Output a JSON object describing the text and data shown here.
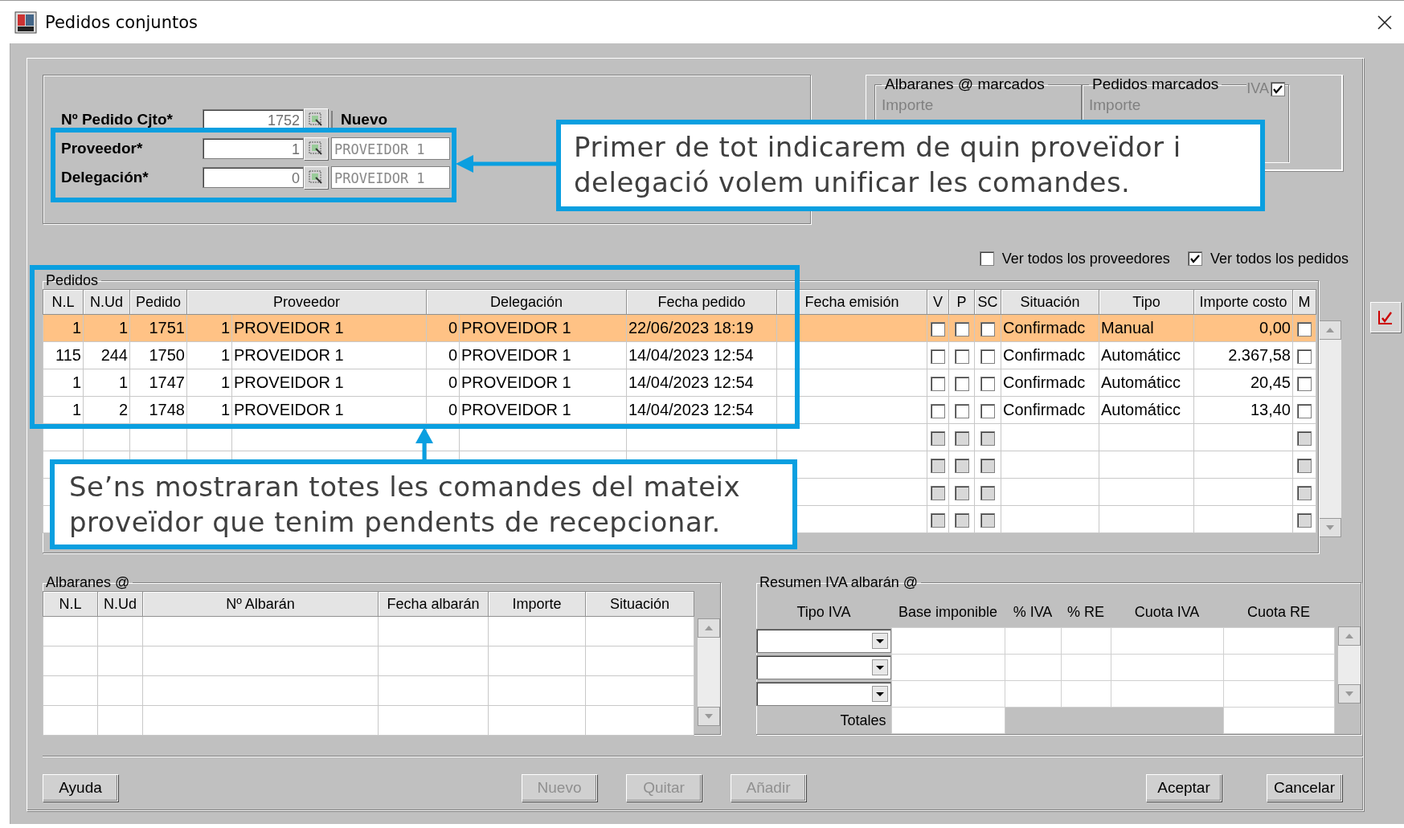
{
  "window": {
    "title": "Pedidos conjuntos"
  },
  "order_fields": [
    {
      "kind": "order",
      "label": "Nº Pedido Cjto*",
      "value": "1752",
      "status": "Nuevo"
    },
    {
      "kind": "lookup",
      "label": "Proveedor*",
      "value": "1",
      "name": "PROVEIDOR 1"
    },
    {
      "kind": "lookup",
      "label": "Delegación*",
      "value": "0",
      "name": "PROVEIDOR 1"
    }
  ],
  "marked_totals": [
    {
      "title": "Albaranes @ marcados",
      "labels": [
        "Importe"
      ]
    },
    {
      "title": "Pedidos marcados",
      "labels": [
        "Importe"
      ],
      "iva": {
        "label": "IVA",
        "checked": true
      }
    }
  ],
  "filters": [
    {
      "label": "Ver todos los proveedores",
      "checked": false
    },
    {
      "label": "Ver todos los pedidos",
      "checked": true
    }
  ],
  "pedidos": {
    "title": "Pedidos",
    "columns": [
      {
        "label": "N.L",
        "kind": "single"
      },
      {
        "label": "N.Ud",
        "kind": "single"
      },
      {
        "label": "Pedido",
        "kind": "single"
      },
      {
        "label": "Proveedor",
        "kind": "pair"
      },
      {
        "label": "Delegación",
        "kind": "pair"
      },
      {
        "label": "Fecha pedido",
        "kind": "single"
      },
      {
        "label": "Fecha emisión",
        "kind": "single"
      },
      {
        "label": "V",
        "kind": "single"
      },
      {
        "label": "P",
        "kind": "single"
      },
      {
        "label": "SC",
        "kind": "single"
      },
      {
        "label": "Situación",
        "kind": "single"
      },
      {
        "label": "Tipo",
        "kind": "single"
      },
      {
        "label": "Importe costo",
        "kind": "single"
      },
      {
        "label": "M",
        "kind": "single"
      }
    ],
    "rows": [
      {
        "selected": true,
        "nl": "1",
        "nud": "1",
        "pedido": "1751",
        "prov_code": "1",
        "prov_name": "PROVEIDOR 1",
        "deleg_code": "0",
        "deleg_name": "PROVEIDOR 1",
        "fecha_pedido": "22/06/2023 18:19",
        "v": false,
        "p": false,
        "sc": false,
        "situacion": "Confirmadc",
        "tipo": "Manual",
        "importe": "0,00",
        "m": false
      },
      {
        "selected": false,
        "nl": "115",
        "nud": "244",
        "pedido": "1750",
        "prov_code": "1",
        "prov_name": "PROVEIDOR 1",
        "deleg_code": "0",
        "deleg_name": "PROVEIDOR 1",
        "fecha_pedido": "14/04/2023 12:54",
        "v": false,
        "p": false,
        "sc": false,
        "situacion": "Confirmadc",
        "tipo": "Automáticc",
        "importe": "2.367,58",
        "m": false
      },
      {
        "selected": false,
        "nl": "1",
        "nud": "1",
        "pedido": "1747",
        "prov_code": "1",
        "prov_name": "PROVEIDOR 1",
        "deleg_code": "0",
        "deleg_name": "PROVEIDOR 1",
        "fecha_pedido": "14/04/2023 12:54",
        "v": false,
        "p": false,
        "sc": false,
        "situacion": "Confirmadc",
        "tipo": "Automáticc",
        "importe": "20,45",
        "m": false
      },
      {
        "selected": false,
        "nl": "1",
        "nud": "2",
        "pedido": "1748",
        "prov_code": "1",
        "prov_name": "PROVEIDOR 1",
        "deleg_code": "0",
        "deleg_name": "PROVEIDOR 1",
        "fecha_pedido": "14/04/2023 12:54",
        "v": false,
        "p": false,
        "sc": false,
        "situacion": "Confirmadc",
        "tipo": "Automáticc",
        "importe": "13,40",
        "m": false
      }
    ]
  },
  "empty_rows": [
    {
      "disabled": true,
      "v": false,
      "p": false,
      "sc": false,
      "m": false
    },
    {
      "disabled": true,
      "v": false,
      "p": false,
      "sc": false,
      "m": false
    },
    {
      "disabled": true,
      "v": false,
      "p": false,
      "sc": false,
      "m": false
    },
    {
      "disabled": true,
      "v": false,
      "p": false,
      "sc": false,
      "m": false
    }
  ],
  "albaranes": {
    "title": "Albaranes @",
    "columns": [
      "N.L",
      "N.Ud",
      "Nº Albarán",
      "Fecha albarán",
      "Importe",
      "Situación"
    ]
  },
  "resumen_iva": {
    "title": "Resumen IVA albarán @",
    "columns": [
      "Tipo IVA",
      "Base imponible",
      "% IVA",
      "% RE",
      "Cuota IVA",
      "Cuota RE"
    ],
    "totals_label": "Totales"
  },
  "buttons": [
    {
      "label": "Ayuda",
      "kind": "left",
      "disabled": false
    },
    {
      "label": "Nuevo",
      "kind": "center",
      "disabled": true
    },
    {
      "label": "Quitar",
      "kind": "center",
      "disabled": true
    },
    {
      "label": "Añadir",
      "kind": "center",
      "disabled": true
    },
    {
      "label": "Aceptar",
      "kind": "right",
      "disabled": false
    },
    {
      "label": "Cancelar",
      "kind": "right",
      "disabled": false
    }
  ],
  "callouts": [
    {
      "kind": "fields",
      "text": "Primer de tot indicarem de quin proveïdor i delegació volem unificar les comandes."
    },
    {
      "kind": "table",
      "text": "Se’ns mostraran totes les comandes del mateix proveïdor que tenim pendents de recepcionar."
    }
  ]
}
